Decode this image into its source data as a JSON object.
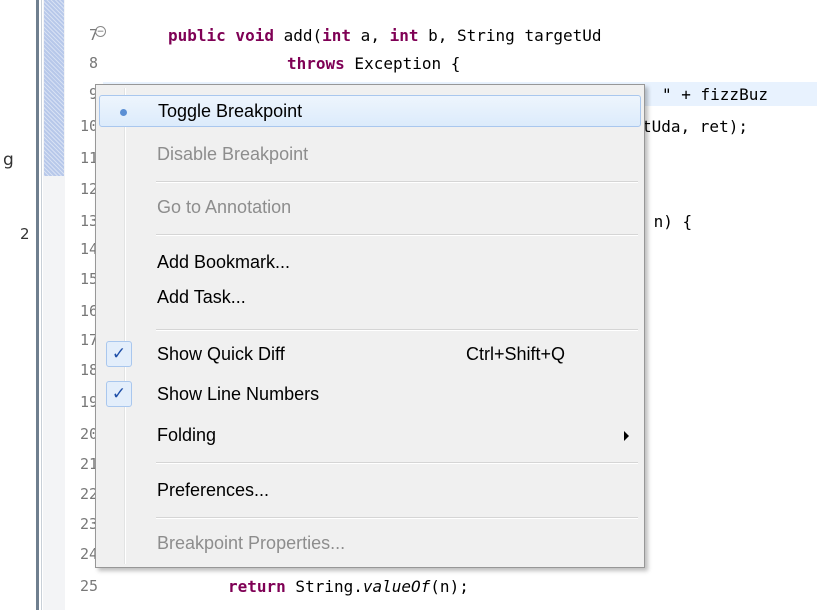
{
  "editor": {
    "line_numbers": [
      "7",
      "8",
      "9",
      "10",
      "11",
      "12",
      "13",
      "14",
      "15",
      "16",
      "17",
      "18",
      "19",
      "20",
      "21",
      "22",
      "23",
      "24",
      "25"
    ],
    "code": {
      "l7_kw1": "public void",
      "l7_mid": " add(",
      "l7_kw2": "int",
      "l7_mid2": " a, ",
      "l7_kw3": "int",
      "l7_tail": " b, String targetUd",
      "l8_kw": "throws",
      "l8_tail": " Exception {",
      "l9_tail": "\" + fizzBuz",
      "l10_tail": "tUda, ret);",
      "l13_tail": " n) {",
      "l25_kw": "return",
      "l25_mid": " String.",
      "l25_it": "valueOf",
      "l25_tail": "(n);"
    },
    "left_fragments": [
      "g",
      "2"
    ]
  },
  "context_menu": {
    "toggle_breakpoint": "Toggle Breakpoint",
    "disable_breakpoint": "Disable Breakpoint",
    "go_to_annotation": "Go to Annotation",
    "add_bookmark": "Add Bookmark...",
    "add_task": "Add Task...",
    "show_quick_diff": "Show Quick Diff",
    "show_quick_diff_shortcut": "Ctrl+Shift+Q",
    "show_line_numbers": "Show Line Numbers",
    "folding": "Folding",
    "preferences": "Preferences...",
    "breakpoint_properties": "Breakpoint Properties...",
    "check_glyph": "✓",
    "show_quick_diff_checked": true,
    "show_line_numbers_checked": true
  },
  "colors": {
    "keyword": "#7f0055",
    "menu_bg": "#f0f0f0",
    "highlight_border": "#a9c7ee",
    "disabled_text": "#8d8d8d"
  }
}
